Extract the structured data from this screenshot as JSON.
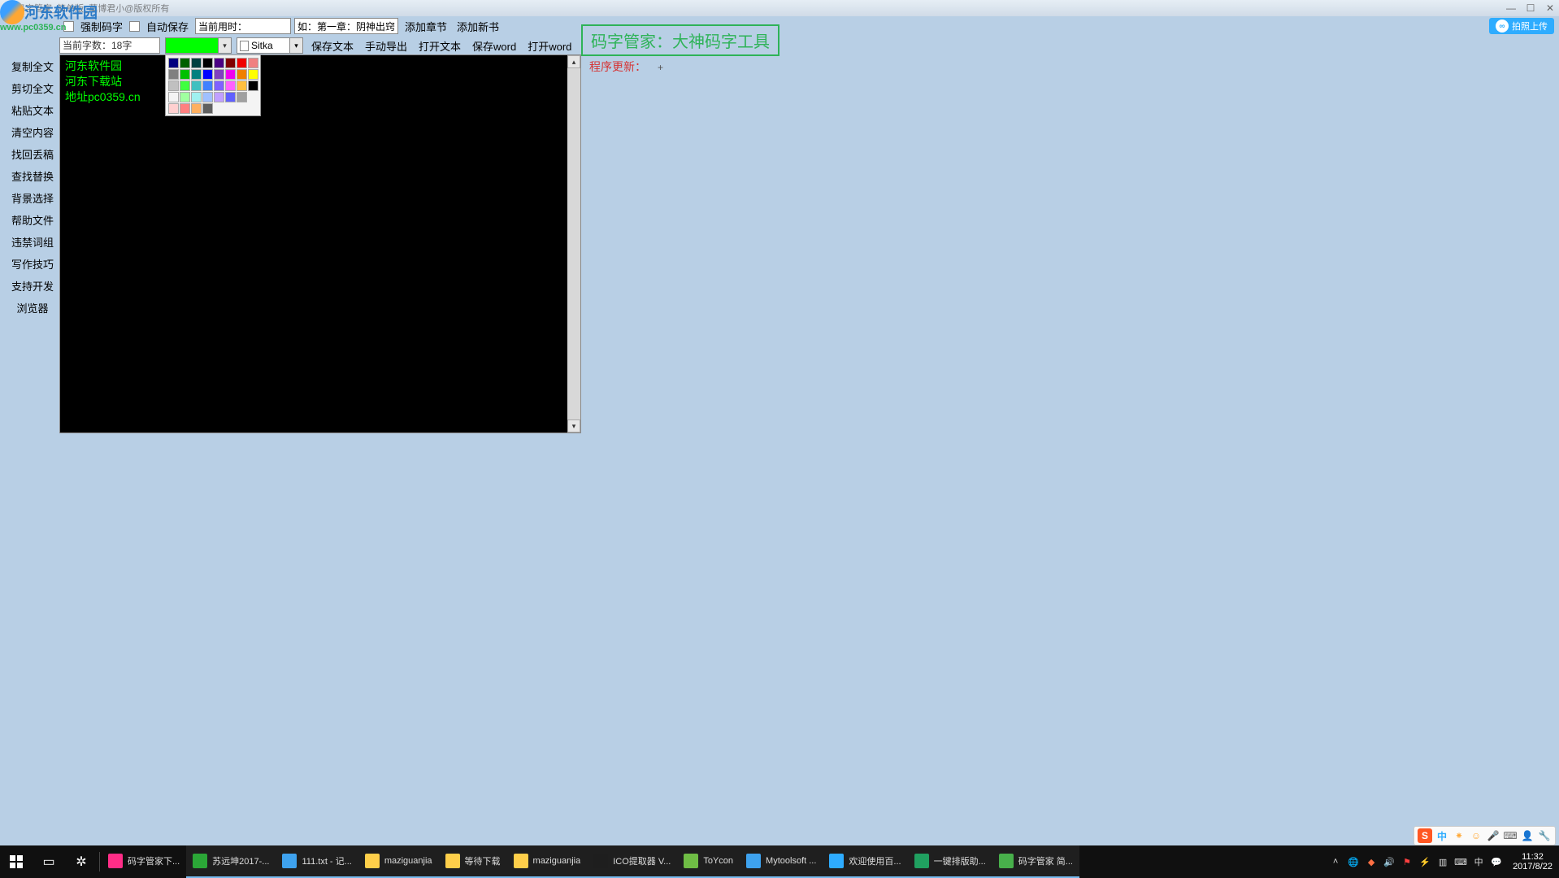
{
  "window": {
    "title": "码字管家_简单版_莫博君小@版权所有"
  },
  "watermark": {
    "text": "河东软件园",
    "url": "www.pc0359.cn"
  },
  "toolbar1": {
    "force_label": "强制码字",
    "autosave_label": "自动保存",
    "time_label_prefix": "当前用时：",
    "chapter_placeholder": "如：第一章：阴神出窍",
    "add_chapter": "添加章节",
    "add_book": "添加新书"
  },
  "toolbar2": {
    "count_text": "当前字数：18字",
    "font_name": "Sitka",
    "save_text": "保存文本",
    "manual_export": "手动导出",
    "open_text": "打开文本",
    "save_word": "保存word",
    "open_word": "打开word"
  },
  "sidebar": {
    "items": [
      "复制全文",
      "剪切全文",
      "粘贴文本",
      "清空内容",
      "找回丢稿",
      "查找替换",
      "背景选择",
      "帮助文件",
      "违禁词组",
      "写作技巧",
      "支持开发",
      "浏览器"
    ]
  },
  "editor": {
    "line1": "河东软件园",
    "line2": "河东下载站",
    "line3": "地址pc0359.cn"
  },
  "banner": "码字管家：大神码字工具",
  "update": {
    "label": "程序更新：",
    "plus": "+"
  },
  "upload": {
    "label": "拍照上传"
  },
  "ime": {
    "label": "中"
  },
  "palette_colors": [
    [
      "#000080",
      "#006000",
      "#004040",
      "#000000",
      "#4b0082",
      "#800000",
      "#f00000",
      "#f08080"
    ],
    [
      "#808080",
      "#00c000",
      "#008080",
      "#0000ff",
      "#8040c0",
      "#f000f0",
      "#f08000",
      "#ffff00"
    ],
    [
      "#c0c0c0",
      "#40ff40",
      "#40c0c0",
      "#4080ff",
      "#8060ff",
      "#ff60ff",
      "#ffc040",
      "#000000"
    ],
    [
      "#f4f4f4",
      "#a0ffa0",
      "#a0f0f0",
      "#a0c0ff",
      "#c0a0ff",
      "#6060ff",
      "#a0a0a0",
      ""
    ],
    [
      "#ffd0d0",
      "#ff8080",
      "#ffb060",
      "#606060",
      "",
      "",
      "",
      ""
    ]
  ],
  "taskbar": {
    "items": [
      {
        "label": "码字管家下...",
        "color": "#ff2d87",
        "running": false
      },
      {
        "label": "苏远坤2017-...",
        "color": "#2ba737",
        "running": true
      },
      {
        "label": "111.txt - 记...",
        "color": "#3ea2ee",
        "running": true
      },
      {
        "label": "maziguanjia",
        "color": "#ffcf4a",
        "running": true
      },
      {
        "label": "等待下载",
        "color": "#ffcf4a",
        "running": true
      },
      {
        "label": "maziguanjia",
        "color": "#ffcf4a",
        "running": true
      },
      {
        "label": "ICO提取器 V...",
        "color": "#1e1e1e",
        "running": true
      },
      {
        "label": "ToYcon",
        "color": "#6fbd45",
        "running": true
      },
      {
        "label": "Mytoolsoft ...",
        "color": "#3ea2ee",
        "running": true
      },
      {
        "label": "欢迎使用百...",
        "color": "#2eacff",
        "running": true
      },
      {
        "label": "一键排版助...",
        "color": "#20a060",
        "running": true
      },
      {
        "label": "码字管家 简...",
        "color": "#48b04b",
        "running": true
      }
    ],
    "clock_time": "11:32",
    "clock_date": "2017/8/22"
  }
}
